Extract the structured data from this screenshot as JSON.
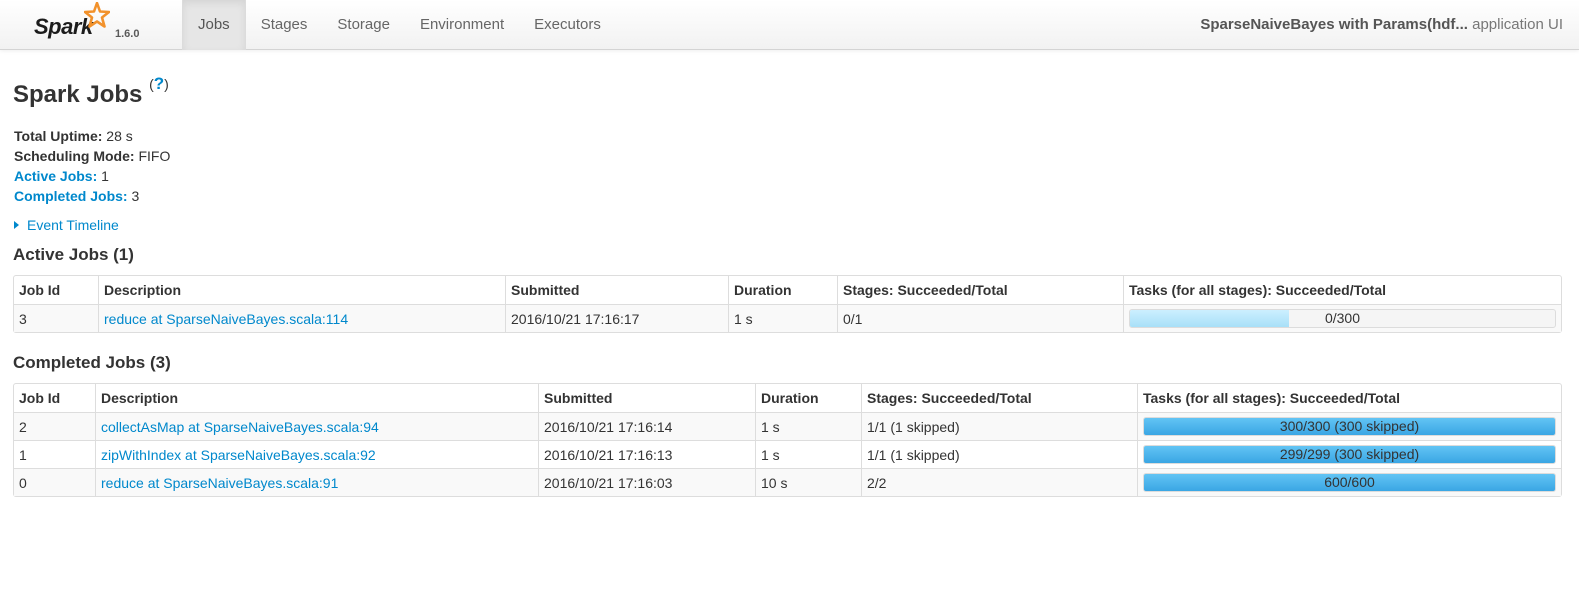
{
  "navbar": {
    "logo_text": "Spark",
    "version": "1.6.0",
    "tabs": [
      "Jobs",
      "Stages",
      "Storage",
      "Environment",
      "Executors"
    ],
    "active_tab": "Jobs",
    "app_name": "SparseNaiveBayes with Params(hdf...",
    "app_suffix": " application UI"
  },
  "page": {
    "title": "Spark Jobs",
    "help_label": "?"
  },
  "summary": {
    "uptime_label": "Total Uptime:",
    "uptime_value": " 28 s",
    "mode_label": "Scheduling Mode:",
    "mode_value": " FIFO",
    "active_label": "Active Jobs:",
    "active_value": " 1",
    "completed_label": "Completed Jobs:",
    "completed_value": " 3"
  },
  "event_timeline_label": "Event Timeline",
  "active_jobs": {
    "heading": "Active Jobs (1)",
    "columns": [
      "Job Id",
      "Description",
      "Submitted",
      "Duration",
      "Stages: Succeeded/Total",
      "Tasks (for all stages): Succeeded/Total"
    ],
    "rows": [
      {
        "id": "3",
        "description": "reduce at SparseNaiveBayes.scala:114",
        "submitted": "2016/10/21 17:16:17",
        "duration": "1 s",
        "stages": "0/1",
        "tasks_label": "0/300",
        "tasks_running_fraction": 0.375,
        "tasks_done_fraction": 0
      }
    ]
  },
  "completed_jobs": {
    "heading": "Completed Jobs (3)",
    "columns": [
      "Job Id",
      "Description",
      "Submitted",
      "Duration",
      "Stages: Succeeded/Total",
      "Tasks (for all stages): Succeeded/Total"
    ],
    "rows": [
      {
        "id": "2",
        "description": "collectAsMap at SparseNaiveBayes.scala:94",
        "submitted": "2016/10/21 17:16:14",
        "duration": "1 s",
        "stages": "1/1 (1 skipped)",
        "tasks_label": "300/300 (300 skipped)",
        "tasks_done_fraction": 1
      },
      {
        "id": "1",
        "description": "zipWithIndex at SparseNaiveBayes.scala:92",
        "submitted": "2016/10/21 17:16:13",
        "duration": "1 s",
        "stages": "1/1 (1 skipped)",
        "tasks_label": "299/299 (300 skipped)",
        "tasks_done_fraction": 1
      },
      {
        "id": "0",
        "description": "reduce at SparseNaiveBayes.scala:91",
        "submitted": "2016/10/21 17:16:03",
        "duration": "10 s",
        "stages": "2/2",
        "tasks_label": "600/600",
        "tasks_done_fraction": 1
      }
    ]
  },
  "colors": {
    "link": "#0088cc",
    "progress_complete": "#3aa6e4",
    "progress_running": "#a8e0f8",
    "logo_star": "#f2922c"
  }
}
